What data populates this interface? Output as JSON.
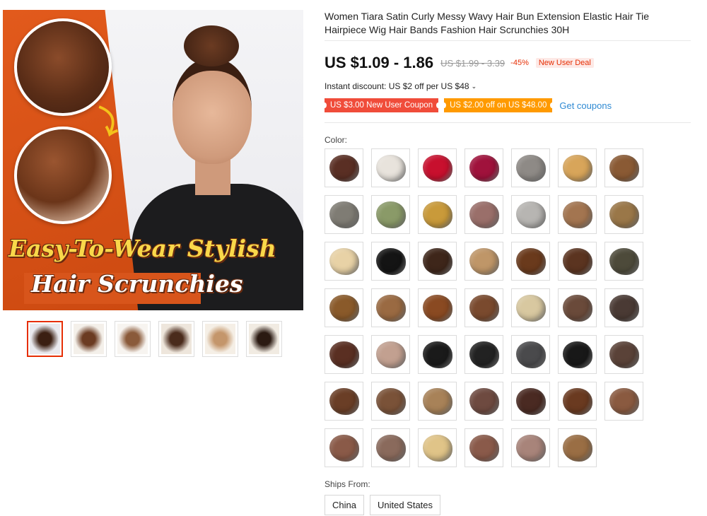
{
  "product": {
    "title": "Women Tiara Satin Curly Messy Wavy Hair Bun Extension Elastic Hair Tie Hairpiece Wig Hair Bands Fashion Hair Scrunchies 30H"
  },
  "gallery": {
    "promo_line1": "Easy-To-Wear Stylish",
    "promo_line2": "Hair Scrunchies",
    "thumbnails": [
      {
        "colors": [
          "#e9e9ee",
          "#3b1f12"
        ]
      },
      {
        "colors": [
          "#f4f0ea",
          "#6b3b22"
        ]
      },
      {
        "colors": [
          "#f7f4f0",
          "#8a5a3a"
        ]
      },
      {
        "colors": [
          "#eee6dc",
          "#4a2b1c"
        ]
      },
      {
        "colors": [
          "#f5efe6",
          "#c4966b"
        ]
      },
      {
        "colors": [
          "#f1ebe2",
          "#2b1a12"
        ]
      }
    ]
  },
  "pricing": {
    "price_range": "US $1.09 - 1.86",
    "original_range": "US $1.99 - 3.39",
    "discount": "-45%",
    "deal_badge": "New User Deal",
    "instant_discount": "Instant discount: US $2 off per US $48",
    "coupon_red": "US $3.00 New User Coupon",
    "coupon_orange": "US $2.00 off on US $48.00",
    "get_coupons": "Get coupons"
  },
  "colors": {
    "accent": "#e62e04",
    "coupon_red": "#f04c3a",
    "coupon_orange": "#ff9a00",
    "link": "#2f8ad3"
  },
  "color_option": {
    "label": "Color:",
    "swatches": [
      "#5a2f24",
      "#e8e3dc",
      "#c8102e",
      "#a0123c",
      "#8e8a86",
      "#d8a55a",
      "#8a5a34",
      "#7f7c74",
      "#8a9a68",
      "#c99a3a",
      "#9a6f6a",
      "#b7b5b2",
      "#a37550",
      "#9a7748",
      "#e8d2a6",
      "#141414",
      "#3e261a",
      "#bf9668",
      "#6a3a1c",
      "#5b3420",
      "#4d4a3a",
      "#8a5a2a",
      "#9a6a42",
      "#8a4a22",
      "#7a4a2e",
      "#d8c8a0",
      "#6a4a3a",
      "#4a3a34",
      "#5a2f22",
      "#c2a090",
      "#1a1a1a",
      "#222222",
      "#4a4a4c",
      "#181818",
      "#5a4238",
      "#6a3e26",
      "#7a5238",
      "#a88258",
      "#6e4a40",
      "#4a2a22",
      "#6a3a20",
      "#8a5a40",
      "#8a5a48",
      "#8a6a5c",
      "#e0c488",
      "#8a5a4a",
      "#a8847a",
      "#9a6e44"
    ]
  },
  "shipping": {
    "label": "Ships From:",
    "options": [
      "China",
      "United States"
    ]
  }
}
